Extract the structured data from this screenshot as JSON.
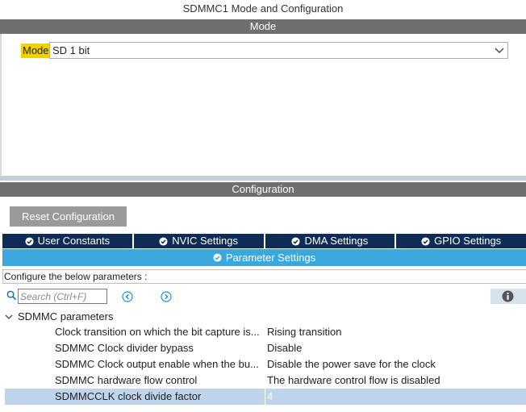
{
  "window": {
    "title": "SDMMC1 Mode and Configuration"
  },
  "mode_section": {
    "header": "Mode",
    "label": "Mode",
    "selected": "SD 1 bit",
    "icon": "chevron-down-icon"
  },
  "config_section": {
    "header": "Configuration",
    "reset_label": "Reset Configuration",
    "tabs": [
      {
        "label": "User Constants",
        "icon": "check-circle-icon"
      },
      {
        "label": "NVIC Settings",
        "icon": "check-circle-icon"
      },
      {
        "label": "DMA Settings",
        "icon": "check-circle-icon"
      },
      {
        "label": "GPIO Settings",
        "icon": "check-circle-icon"
      }
    ],
    "active_tab": {
      "label": "Parameter Settings",
      "icon": "check-circle-icon"
    },
    "instructions": "Configure the below parameters :",
    "search": {
      "placeholder": "Search (Ctrl+F)",
      "value": ""
    },
    "group": {
      "label": "SDMMC parameters",
      "params": [
        {
          "name": "Clock transition on which the bit capture is...",
          "value": "Rising transition"
        },
        {
          "name": "SDMMC Clock divider bypass",
          "value": "Disable"
        },
        {
          "name": "SDMMC Clock output enable when the bu...",
          "value": "Disable the power save for the clock"
        },
        {
          "name": "SDMMC hardware flow control",
          "value": "The hardware control flow is disabled"
        },
        {
          "name": "SDMMCCLK clock divide factor",
          "value": "4"
        }
      ]
    }
  },
  "colors": {
    "header_bar": "#6f6f6f",
    "tab_bg": "#0f2c56",
    "active_tab_bg": "#3aa7dd",
    "selected_row": "#bdd4ea",
    "mode_highlight": "#f2d100"
  }
}
